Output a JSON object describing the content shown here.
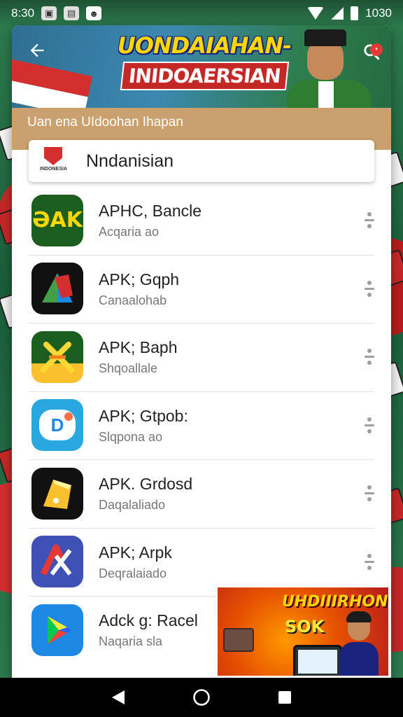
{
  "status_bar": {
    "time": "8:30",
    "battery_text": "1030",
    "icons": [
      "image-icon",
      "notification-icon",
      "wifi-icon",
      "signal-icon",
      "battery-icon"
    ]
  },
  "header": {
    "banner_line1": "UONDAIAHAN-",
    "banner_line2": "INIDOAERSIAN",
    "back_icon": "back-arrow-icon",
    "search_icon": "search-icon",
    "badge_color": "#e53935"
  },
  "section": {
    "title": "Uan ena UIdoohan Ihapan"
  },
  "country": {
    "name": "Nndanisian",
    "crest_text": "INDONESIA"
  },
  "apps": [
    {
      "name": "APHC, Bancle",
      "sub": "Acqaria ao",
      "icon": "ajak-icon",
      "icon_text": "ƏAK"
    },
    {
      "name": "APK; Gqph",
      "sub": "Canaalohab",
      "icon": "map-arrow-icon",
      "icon_text": ""
    },
    {
      "name": "APK; Baph",
      "sub": "Shqoallale",
      "icon": "crossed-swords-icon",
      "icon_text": ""
    },
    {
      "name": "APK; Gtpob:",
      "sub": "Slqpona ao",
      "icon": "chat-bubble-icon",
      "icon_text": "D"
    },
    {
      "name": "APK. Grdosd",
      "sub": "Daqalaliado",
      "icon": "golden-card-icon",
      "icon_text": ""
    },
    {
      "name": "APK; Arpk",
      "sub": "Deqralaiado",
      "icon": "red-x-logo-icon",
      "icon_text": ""
    },
    {
      "name": "Adck g: Racel",
      "sub": "Naqaria sla",
      "icon": "play-store-icon",
      "icon_text": ""
    }
  ],
  "ad": {
    "line1": "UHDIIIRHON",
    "line2": "SOK"
  },
  "colors": {
    "section_bar": "#c9a06e",
    "banner_title": "#ffd600",
    "banner_sub_bg": "#c62828"
  }
}
